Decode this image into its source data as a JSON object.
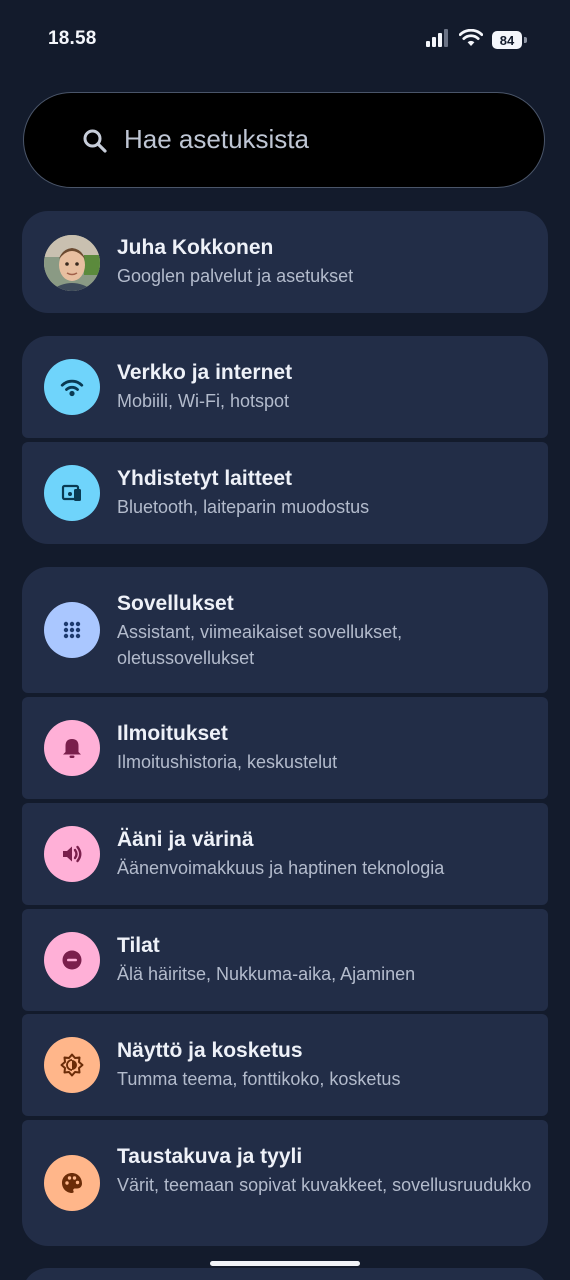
{
  "status_bar": {
    "time": "18.58",
    "battery": "84",
    "icons": [
      "signal-icon",
      "wifi-icon",
      "battery-icon"
    ]
  },
  "search": {
    "placeholder": "Hae asetuksista",
    "icon": "search-icon"
  },
  "account": {
    "name": "Juha Kokkonen",
    "subtitle": "Googlen palvelut ja asetukset"
  },
  "groups": [
    {
      "items": [
        {
          "title": "Verkko ja internet",
          "subtitle": "Mobiili, Wi-Fi, hotspot",
          "icon": "wifi-icon",
          "color": "#6fd4fb"
        },
        {
          "title": "Yhdistetyt laitteet",
          "subtitle": "Bluetooth, laiteparin muodostus",
          "icon": "connected-devices-icon",
          "color": "#6fd4fb"
        }
      ]
    },
    {
      "items": [
        {
          "title": "Sovellukset",
          "subtitle": "Assistant, viimeaikaiset sovellukset, oletussovellukset",
          "icon": "apps-grid-icon",
          "color": "#aac7ff"
        },
        {
          "title": "Ilmoitukset",
          "subtitle": "Ilmoitushistoria, keskustelut",
          "icon": "bell-icon",
          "color": "#ffb0d7"
        },
        {
          "title": "Ääni ja värinä",
          "subtitle": "Äänenvoimakkuus ja haptinen teknologia",
          "icon": "volume-icon",
          "color": "#ffb0d7"
        },
        {
          "title": "Tilat",
          "subtitle": "Älä häiritse, Nukkuma-aika, Ajaminen",
          "icon": "do-not-disturb-icon",
          "color": "#ffb0d7"
        },
        {
          "title": "Näyttö ja kosketus",
          "subtitle": "Tumma teema, fonttikoko, kosketus",
          "icon": "brightness-icon",
          "color": "#ffb68a"
        },
        {
          "title": "Taustakuva ja tyyli",
          "subtitle": "Värit, teemaan sopivat kuvakkeet, sovellusruudukko",
          "icon": "palette-icon",
          "color": "#ffb68a"
        }
      ]
    }
  ],
  "colors": {
    "background": "#131b2c",
    "card": "#222d47",
    "search_background": "#000000"
  }
}
